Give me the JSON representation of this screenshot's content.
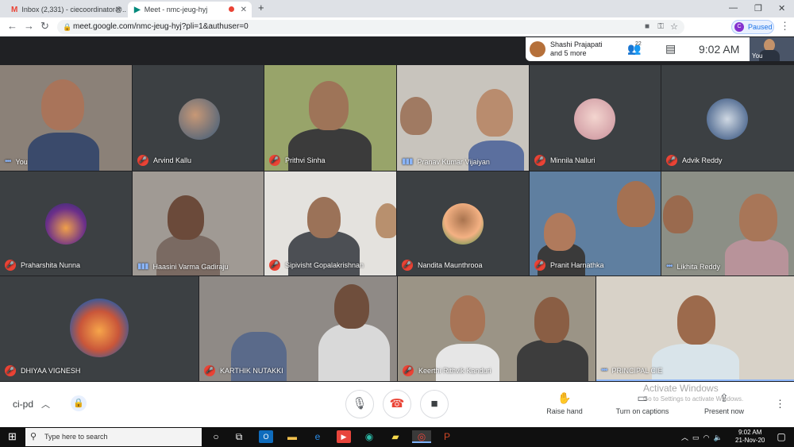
{
  "browser": {
    "tabs": [
      {
        "icon": "gmail-icon",
        "title": "Inbox (2,331) - ciecoordinator@..."
      },
      {
        "icon": "meet-icon",
        "title": "Meet - nmc-jeug-hyj"
      }
    ],
    "new_tab": "+",
    "url": "meet.google.com/nmc-jeug-hyj?pli=1&authuser=0",
    "profile_initial": "C",
    "profile_status": "Paused"
  },
  "meet": {
    "presenter": {
      "name": "Shashi Prajapati",
      "more": "and 5 more"
    },
    "participant_count": "22",
    "time": "9:02 AM",
    "self_label": "You",
    "tiles": [
      {
        "name": "You",
        "state": "speaking"
      },
      {
        "name": "Arvind Kallu",
        "state": "muted"
      },
      {
        "name": "Prithvi Sinha",
        "state": "muted"
      },
      {
        "name": "Pranav Kumar Vijaiyan",
        "state": "speaking"
      },
      {
        "name": "Minnila Nalluri",
        "state": "muted"
      },
      {
        "name": "Advik Reddy",
        "state": "muted"
      },
      {
        "name": "Praharshita Nunna",
        "state": "muted"
      },
      {
        "name": "Haasini Varma Gadiraju",
        "state": "speaking"
      },
      {
        "name": "Sipivisht Gopalakrishnan",
        "state": "muted"
      },
      {
        "name": "Nandita Maunthrooa",
        "state": "muted"
      },
      {
        "name": "Pranit Harnathka",
        "state": "muted"
      },
      {
        "name": "Likhita Reddy",
        "state": "speaking"
      },
      {
        "name": "DHIYAA VIGNESH",
        "state": "muted"
      },
      {
        "name": "KARTHIK NUTAKKI",
        "state": "muted"
      },
      {
        "name": "Keerthi Rithvik Kanduri",
        "state": "muted"
      },
      {
        "name": "PRINCIPAL CIE",
        "state": "speaking"
      }
    ],
    "bottom": {
      "meeting_code": "ci-pd",
      "raise_hand": "Raise hand",
      "captions": "Turn on captions",
      "present": "Present now"
    },
    "watermark": {
      "title": "Activate Windows",
      "subtitle": "Go to Settings to activate Windows."
    }
  },
  "taskbar": {
    "search_placeholder": "Type here to search",
    "time": "9:02 AM",
    "date": "21-Nov-20"
  },
  "colors": {
    "muted_red": "#ea4335",
    "meet_bg": "#202124",
    "accent_blue": "#1a73e8"
  }
}
